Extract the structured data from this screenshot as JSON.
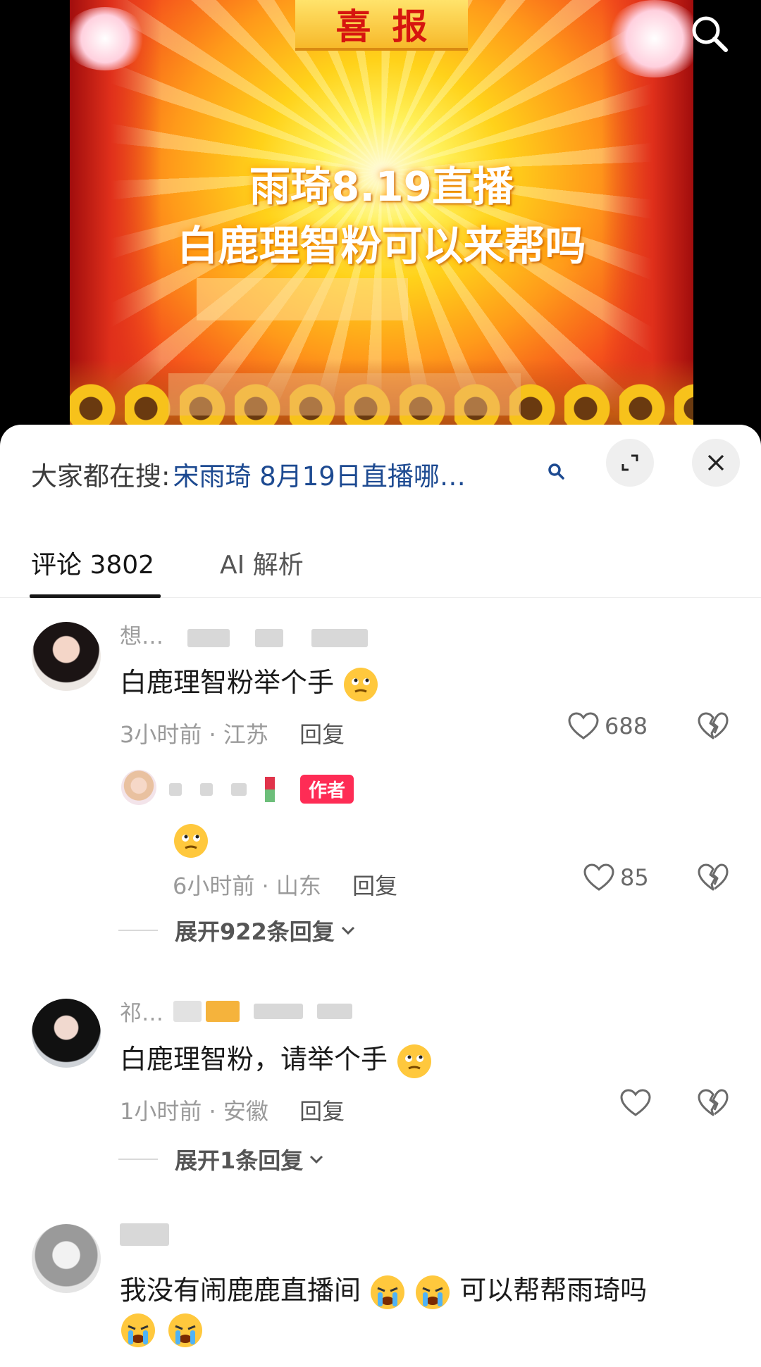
{
  "video": {
    "banner": "喜报",
    "line1": "雨琦8.19直播",
    "line2": "白鹿理智粉可以来帮吗"
  },
  "panel": {
    "suggest_label": "大家都在搜:",
    "suggest_query": "宋雨琦 8月19日直播哪…"
  },
  "tabs": [
    {
      "label": "评论 3802",
      "active": true
    },
    {
      "label": "AI 解析",
      "active": false
    }
  ],
  "comments": [
    {
      "username": "想…",
      "text": "白鹿理智粉举个手",
      "time_location": "3小时前 · 江苏",
      "reply_label": "回复",
      "likes": "688",
      "reply": {
        "badge": "作者",
        "time_location": "6小时前 · 山东",
        "reply_label": "回复",
        "likes": "85"
      },
      "expand_label": "展开922条回复"
    },
    {
      "username": "祁…",
      "text": "白鹿理智粉，请举个手",
      "time_location": "1小时前 · 安徽",
      "reply_label": "回复",
      "likes": "",
      "expand_label": "展开1条回复"
    },
    {
      "username": "",
      "text": "我没有闹鹿鹿直播间",
      "text_tail": "可以帮帮雨琦吗"
    }
  ],
  "colors": {
    "link_blue": "#1d4a91",
    "author_badge": "#fe2c55",
    "panel_bg": "#ffffff"
  }
}
